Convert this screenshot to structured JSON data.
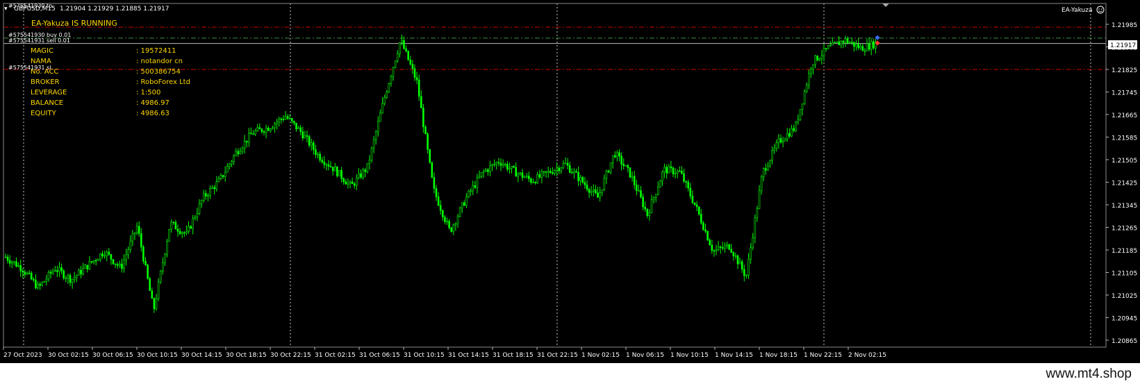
{
  "header": {
    "symbol_tf": "GBPUSD,M15",
    "ohlc": "1.21904 1.21929 1.21885 1.21917",
    "overlapped_label": "#575541930 tp"
  },
  "ea": {
    "label": "EA-Yakuza",
    "status": "EA-Yakuza IS RUNNING",
    "info": [
      {
        "key": "MAGIC",
        "value": ": 19572411"
      },
      {
        "key": "NAMA",
        "value": ": notandor cn"
      },
      {
        "key": "No. ACC",
        "value": ": 500386754"
      },
      {
        "key": "BROKER",
        "value": ": RoboForex Ltd"
      },
      {
        "key": "LEVERAGE",
        "value": ": 1:500"
      },
      {
        "key": "BALANCE",
        "value": ": 4986.97"
      },
      {
        "key": "EQUITY",
        "value": ": 4986.63"
      }
    ]
  },
  "orders": [
    {
      "text": "#575541930 buy 0.01"
    },
    {
      "text": "#575541931 sell 0.01"
    },
    {
      "text": "#575541931 sl"
    }
  ],
  "price_axis": {
    "ticks": [
      "1.21985",
      "1.21905",
      "1.21825",
      "1.21745",
      "1.21665",
      "1.21585",
      "1.21505",
      "1.21425",
      "1.21345",
      "1.21265",
      "1.21185",
      "1.21105",
      "1.21025",
      "1.20945",
      "1.20865"
    ],
    "current": "1.21917"
  },
  "time_axis": {
    "ticks": [
      "27 Oct 2023",
      "30 Oct 02:15",
      "30 Oct 06:15",
      "30 Oct 10:15",
      "30 Oct 14:15",
      "30 Oct 18:15",
      "30 Oct 22:15",
      "31 Oct 02:15",
      "31 Oct 06:15",
      "31 Oct 10:15",
      "31 Oct 14:15",
      "31 Oct 18:15",
      "31 Oct 22:15",
      "1 Nov 02:15",
      "1 Nov 06:15",
      "1 Nov 10:15",
      "1 Nov 14:15",
      "1 Nov 18:15",
      "1 Nov 22:15",
      "2 Nov 02:15"
    ]
  },
  "colors": {
    "background": "#000000",
    "candle": "#00ff00",
    "text": "#ffffff",
    "ea_text": "#ffd700",
    "sl_line": "#c80000",
    "order_line": "#3c8c3c",
    "grid": "#c8c8c8"
  },
  "chart_data": {
    "type": "candlestick",
    "symbol": "GBPUSD",
    "timeframe": "M15",
    "ylim": [
      1.20865,
      1.21985
    ],
    "x": [
      "27 Oct 2023",
      "30 Oct 02:15",
      "30 Oct 06:15",
      "30 Oct 10:15",
      "30 Oct 14:15",
      "30 Oct 18:15",
      "30 Oct 22:15",
      "31 Oct 02:15",
      "31 Oct 06:15",
      "31 Oct 10:15",
      "31 Oct 14:15",
      "31 Oct 18:15",
      "31 Oct 22:15",
      "1 Nov 02:15",
      "1 Nov 06:15",
      "1 Nov 10:15",
      "1 Nov 14:15",
      "1 Nov 18:15",
      "1 Nov 22:15",
      "2 Nov 02:15"
    ],
    "path": [
      1.2116,
      1.2112,
      1.2105,
      1.2112,
      1.2108,
      1.2113,
      1.2118,
      1.2112,
      1.2127,
      1.2097,
      1.2128,
      1.2124,
      1.2137,
      1.2143,
      1.2153,
      1.216,
      1.2162,
      1.2166,
      1.216,
      1.2152,
      1.2147,
      1.2141,
      1.2148,
      1.2172,
      1.2193,
      1.2178,
      1.214,
      1.2125,
      1.2137,
      1.2146,
      1.215,
      1.2146,
      1.2143,
      1.2146,
      1.2149,
      1.2143,
      1.2137,
      1.2153,
      1.2145,
      1.2131,
      1.2147,
      1.2146,
      1.2133,
      1.2118,
      1.212,
      1.2109,
      1.2146,
      1.2157,
      1.2162,
      1.2185,
      1.219,
      1.2193,
      1.219,
      1.2192
    ],
    "levels": {
      "sl": [
        1.21975,
        1.21825
      ],
      "buy": 1.21936,
      "sell": 1.21917
    }
  }
}
